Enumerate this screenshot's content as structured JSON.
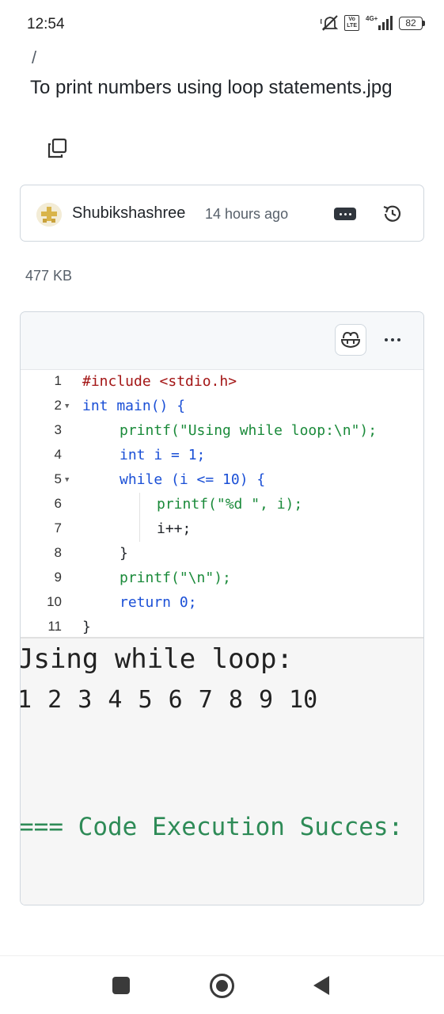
{
  "status_bar": {
    "time": "12:54",
    "network": "4G+",
    "volte": "Vo LTE",
    "battery": "82",
    "icons": [
      "mute-icon",
      "volte-icon",
      "signal-icon",
      "battery-icon"
    ]
  },
  "file": {
    "breadcrumb": "/",
    "title": "To print numbers using loop statements.jpg",
    "size": "477  KB"
  },
  "commit": {
    "author": "Shubikshashree",
    "time_ago": "14 hours ago"
  },
  "code_lines": [
    {
      "num": "1",
      "text": "#include <stdio.h>"
    },
    {
      "num": "2",
      "text": "int main() {"
    },
    {
      "num": "3",
      "text": "printf(\"Using while loop:\\n\");"
    },
    {
      "num": "4",
      "text": "int i = 1;"
    },
    {
      "num": "5",
      "text": "while (i <= 10) {"
    },
    {
      "num": "6",
      "text": "printf(\"%d \", i);"
    },
    {
      "num": "7",
      "text": "i++;"
    },
    {
      "num": "8",
      "text": "}"
    },
    {
      "num": "9",
      "text": "printf(\"\\n\");"
    },
    {
      "num": "10",
      "text": "return 0;"
    },
    {
      "num": "11",
      "text": "}"
    }
  ],
  "output": {
    "line1": "Jsing while loop:",
    "line2": "1 2 3 4 5 6 7 8 9 10",
    "status": "=== Code Execution Succes:"
  },
  "colors": {
    "keyword": "#1a4fd6",
    "string": "#1a8a3a",
    "include": "#a31515",
    "success": "#2e8b57",
    "border": "#d0d7de"
  }
}
